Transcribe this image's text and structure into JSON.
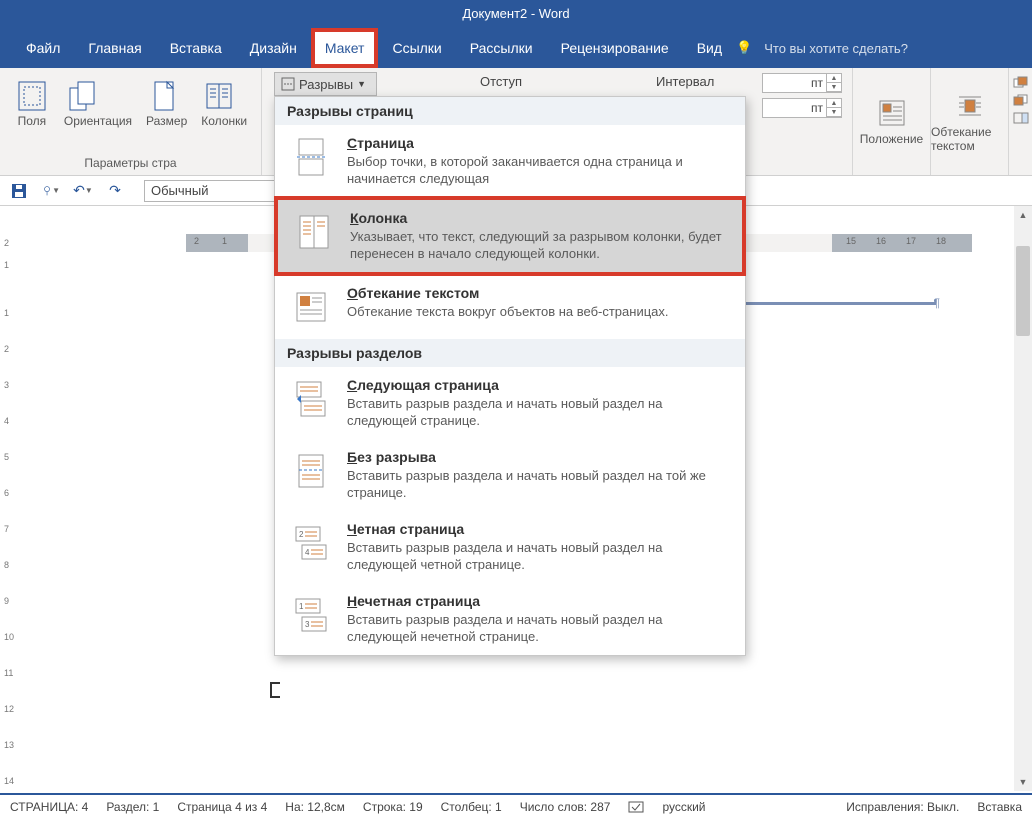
{
  "title": "Документ2 - Word",
  "menu": {
    "file": "Файл",
    "home": "Главная",
    "insert": "Вставка",
    "design": "Дизайн",
    "layout": "Макет",
    "refs": "Ссылки",
    "mail": "Рассылки",
    "review": "Рецензирование",
    "view": "Вид",
    "tell": "Что вы хотите сделать?"
  },
  "ribbon": {
    "margins": "Поля",
    "orientation": "Ориентация",
    "size": "Размер",
    "columns": "Колонки",
    "page_setup_caption": "Параметры стра",
    "breaks_button": "Разрывы",
    "indent_label": "Отступ",
    "interval_label": "Интервал",
    "spin1_value": "пт",
    "spin2_value": "пт",
    "position": "Положение",
    "wrap": "Обтекание текстом"
  },
  "qat": {
    "style_name": "Обычный"
  },
  "dropdown": {
    "page_breaks_header": "Разрывы страниц",
    "section_breaks_header": "Разрывы разделов",
    "items_page": [
      {
        "title": "Страница",
        "ukey": "С",
        "desc": "Выбор точки, в которой заканчивается одна страница и начинается следующая"
      },
      {
        "title": "Колонка",
        "ukey": "К",
        "desc": "Указывает, что текст, следующий за разрывом колонки, будет перенесен в начало следующей колонки."
      },
      {
        "title": "Обтекание текстом",
        "ukey": "О",
        "desc": "Обтекание текста вокруг объектов на веб-страницах."
      }
    ],
    "items_section": [
      {
        "title": "Следующая страница",
        "ukey": "С",
        "desc": "Вставить разрыв раздела и начать новый раздел на следующей странице."
      },
      {
        "title": "Без разрыва",
        "ukey": "Б",
        "desc": "Вставить разрыв раздела и начать новый раздел на той же странице."
      },
      {
        "title": "Четная страница",
        "ukey": "Ч",
        "desc": "Вставить разрыв раздела и начать новый раздел на следующей четной странице."
      },
      {
        "title": "Нечетная страница",
        "ukey": "Н",
        "desc": "Вставить разрыв раздела и начать новый раздел на следующей нечетной странице."
      }
    ]
  },
  "ruler": {
    "h_left_ticks": [
      "2",
      "1"
    ],
    "h_ticks_right": [
      "15",
      "16",
      "17",
      "18"
    ]
  },
  "status": {
    "page": "СТРАНИЦА: 4",
    "section": "Раздел: 1",
    "page_of": "Страница 4 из 4",
    "pos": "На: 12,8см",
    "line": "Строка: 19",
    "col": "Столбец: 1",
    "words": "Число слов: 287",
    "lang": "русский",
    "track": "Исправления: Выкл.",
    "mode": "Вставка"
  }
}
